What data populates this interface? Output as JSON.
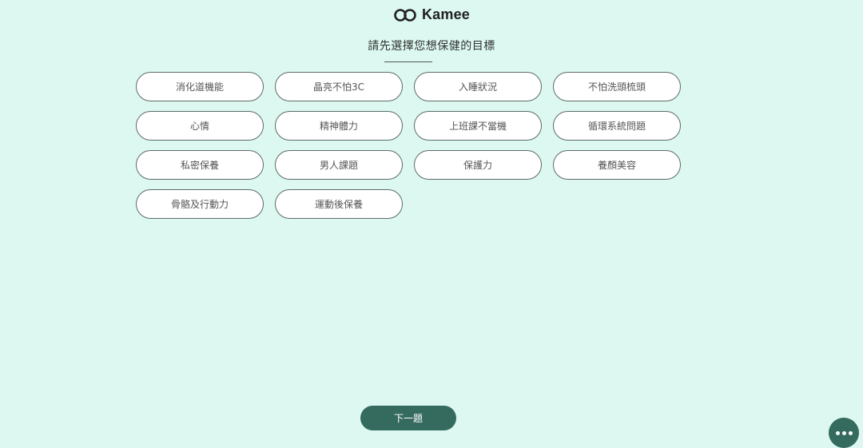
{
  "header": {
    "logo_text": "Kamee",
    "logo_icon": "infinity-link-icon"
  },
  "question": {
    "title": "請先選擇您想保健的目標"
  },
  "options": [
    {
      "label": "消化道機能"
    },
    {
      "label": "晶亮不怕3C"
    },
    {
      "label": "入睡狀況"
    },
    {
      "label": "不怕洗頭梳頭"
    },
    {
      "label": "心情"
    },
    {
      "label": "精神體力"
    },
    {
      "label": "上班課不當機"
    },
    {
      "label": "循環系統問題"
    },
    {
      "label": "私密保養"
    },
    {
      "label": "男人課題"
    },
    {
      "label": "保護力"
    },
    {
      "label": "養顏美容"
    },
    {
      "label": "骨骼及行動力"
    },
    {
      "label": "運動後保養"
    }
  ],
  "footer": {
    "next_label": "下一題"
  },
  "chat": {
    "icon": "more-dots-icon"
  },
  "colors": {
    "background": "#dcf8f0",
    "primary": "#356a5e",
    "pill_border": "#5d6b67"
  }
}
